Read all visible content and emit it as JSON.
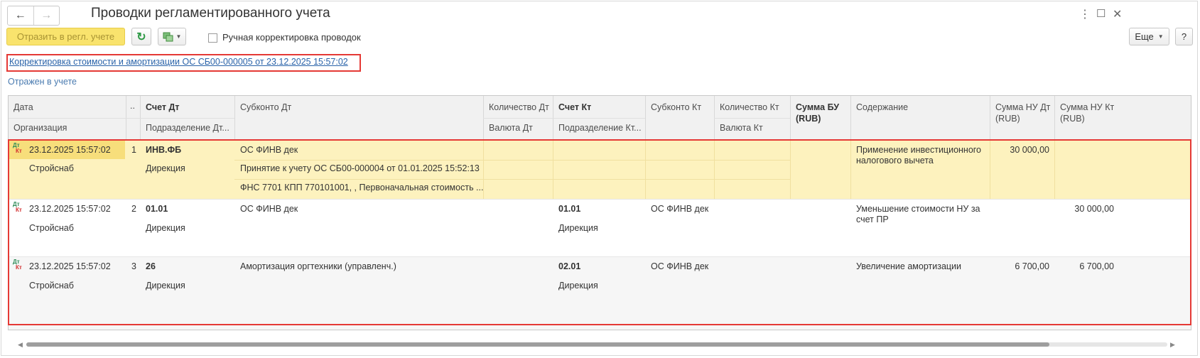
{
  "window": {
    "title": "Проводки регламентированного учета"
  },
  "toolbar": {
    "post_label": "Отразить в регл. учете",
    "manual_label": "Ручная корректировка проводок",
    "more_label": "Еще",
    "help_label": "?"
  },
  "document": {
    "link": "Корректировка стоимости и амортизации ОС СБ00-000005 от 23.12.2025 15:57:02",
    "status": "Отражен в учете"
  },
  "columns": {
    "date": "Дата",
    "org": "Организация",
    "num": "..",
    "acc_dt": "Счет Дт",
    "dept_dt": "Подразделение Дт...",
    "sub_dt": "Субконто Дт",
    "qty_dt": "Количество Дт",
    "cur_dt": "Валюта Дт",
    "acc_kt": "Счет Кт",
    "dept_kt": "Подразделение Кт...",
    "sub_kt": "Субконто Кт",
    "qty_kt": "Количество Кт",
    "cur_kt": "Валюта Кт",
    "sum_bu": "Сумма БУ",
    "sum_bu_cur": "(RUB)",
    "content": "Содержание",
    "sum_nu_dt": "Сумма НУ Дт",
    "sum_nu_dt_cur": "(RUB)",
    "sum_nu_kt": "Сумма НУ Кт",
    "sum_nu_kt_cur": "(RUB)"
  },
  "rows": [
    {
      "icon_dt": "Дт",
      "icon_kt": "Кт",
      "date": "23.12.2025 15:57:02",
      "org": "Стройснаб",
      "num": "1",
      "acc_dt": "ИНВ.ФБ",
      "dept_dt": "Дирекция",
      "sub_dt_1": "ОС ФИНВ дек",
      "sub_dt_2": "Принятие к учету ОС СБ00-000004 от 01.01.2025 15:52:13",
      "sub_dt_3": "ФНС 7701 КПП 770101001, , Первоначальная стоимость ...",
      "acc_kt": "",
      "dept_kt": "",
      "sub_kt": "",
      "content_1": "Применение инвестиционного",
      "content_2": "налогового вычета",
      "sum_nu_dt": "30 000,00",
      "sum_nu_kt": ""
    },
    {
      "icon_dt": "Дт",
      "icon_kt": "Кт",
      "date": "23.12.2025 15:57:02",
      "org": "Стройснаб",
      "num": "2",
      "acc_dt": "01.01",
      "dept_dt": "Дирекция",
      "sub_dt_1": "ОС ФИНВ дек",
      "acc_kt": "01.01",
      "dept_kt": "Дирекция",
      "sub_kt": "ОС ФИНВ дек",
      "content_1": "Уменьшение стоимости НУ за",
      "content_2": "счет ПР",
      "sum_nu_dt": "",
      "sum_nu_kt": "30 000,00"
    },
    {
      "icon_dt": "Дт",
      "icon_kt": "Кт",
      "date": "23.12.2025 15:57:02",
      "org": "Стройснаб",
      "num": "3",
      "acc_dt": "26",
      "dept_dt": "Дирекция",
      "sub_dt_1": "Амортизация оргтехники (управленч.)",
      "acc_kt": "02.01",
      "dept_kt": "Дирекция",
      "sub_kt": "ОС ФИНВ дек",
      "content_1": "Увеличение амортизации",
      "content_2": "",
      "sum_nu_dt": "6 700,00",
      "sum_nu_kt": "6 700,00"
    }
  ],
  "colors": {
    "selected_row": "#fdf2be",
    "selected_date": "#f7de7b",
    "highlight_border": "#e53935",
    "link": "#2a63a9",
    "post_button": "#f9e36d"
  }
}
